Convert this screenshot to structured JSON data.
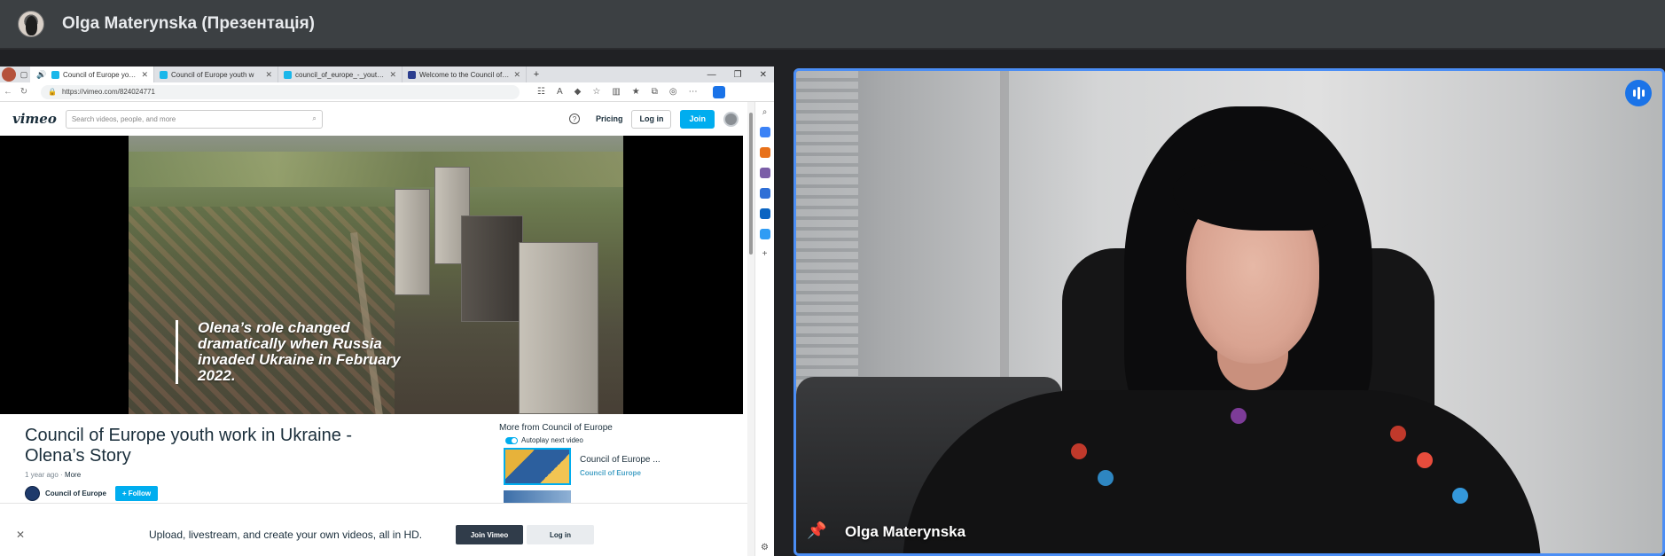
{
  "meeting": {
    "presenter_title": "Olga Materynska (Презентація)",
    "camera_name": "Olga Materynska"
  },
  "browser": {
    "tabs": [
      {
        "title": "Council of Europe youth wo",
        "active": true
      },
      {
        "title": "Council of Europe youth w",
        "active": false
      },
      {
        "title": "council_of_europe_-_youth_work",
        "active": false
      },
      {
        "title": "Welcome to the Council of Euro",
        "active": false
      }
    ],
    "url": "https://vimeo.com/824024771"
  },
  "vimeo": {
    "logo": "vimeo",
    "search_placeholder": "Search videos, people, and more",
    "pricing": "Pricing",
    "login": "Log in",
    "join": "Join",
    "video_caption": "Olena’s role changed dramatically when Russia invaded Ukraine in February 2022.",
    "video_title": "Council of Europe youth work in Ukraine - Olena’s Story",
    "posted": "1 year ago",
    "more": "More",
    "channel": "Council of Europe",
    "follow": "+ Follow",
    "more_from": "More from Council of Europe",
    "autoplay": "Autoplay next video",
    "rec_title": "Council of Europe ...",
    "rec_channel": "Council of Europe",
    "banner_text": "Upload, livestream, and create your own videos, all in HD.",
    "banner_join": "Join Vimeo",
    "banner_login": "Log in"
  },
  "colors": {
    "accent_blue": "#4b8ef5",
    "vimeo_blue": "#00adef",
    "meet_bar": "#3c4043"
  }
}
